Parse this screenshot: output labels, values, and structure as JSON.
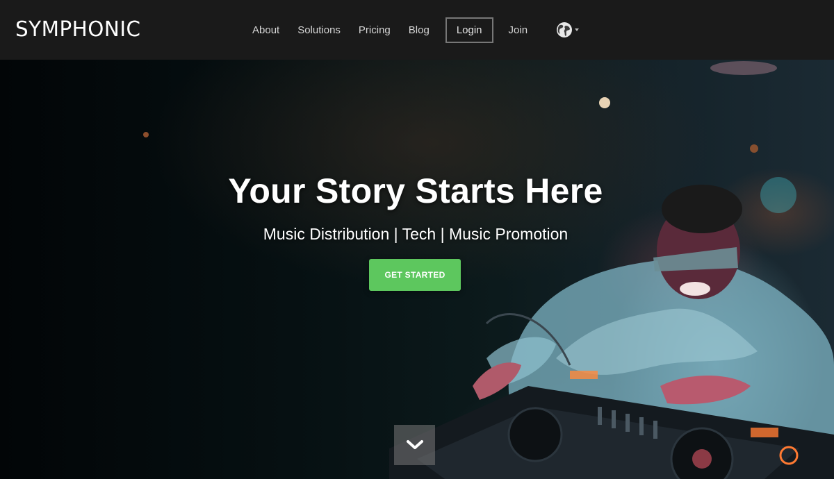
{
  "brand": {
    "logo_text": "SYMPHONIC"
  },
  "nav": {
    "items": [
      {
        "label": "About"
      },
      {
        "label": "Solutions"
      },
      {
        "label": "Pricing"
      },
      {
        "label": "Blog"
      }
    ],
    "login_label": "Login",
    "join_label": "Join",
    "language_icon": "globe-icon"
  },
  "hero": {
    "headline": "Your Story Starts Here",
    "subheadline": "Music Distribution | Tech | Music Promotion",
    "cta_label": "GET STARTED",
    "scroll_icon": "chevron-down-icon"
  },
  "colors": {
    "topbar_bg": "#1a1a1a",
    "cta_green": "#5dc75e",
    "text_white": "#ffffff"
  }
}
